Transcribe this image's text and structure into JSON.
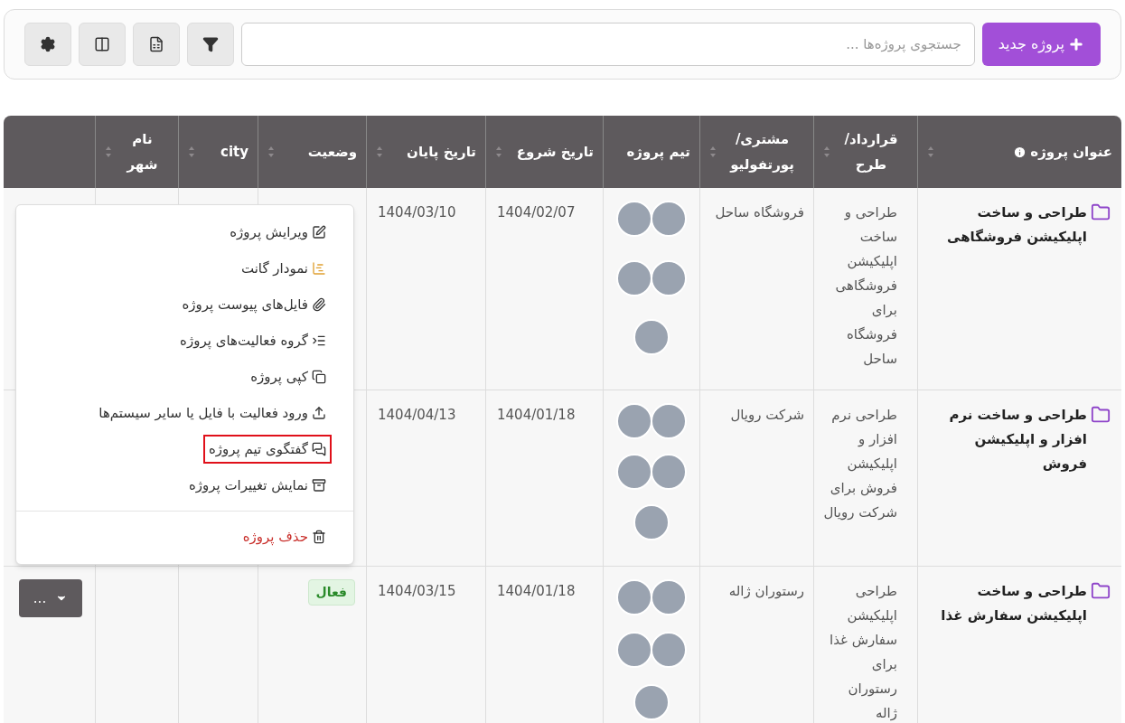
{
  "toolbar": {
    "new_button": "پروژه جدید",
    "search": {
      "placeholder": "جستجوی پروژه‌ها ..."
    },
    "tools": [
      {
        "kind": "filter"
      },
      {
        "kind": "excel"
      },
      {
        "kind": "columns"
      },
      {
        "kind": "settings"
      }
    ]
  },
  "table": {
    "columns": [
      {
        "label": "عنوان پروژه",
        "sortable": true,
        "info": true
      },
      {
        "label": "قرارداد/ طرح",
        "sortable": true,
        "info": false
      },
      {
        "label": "مشتری/ پورتفولیو",
        "sortable": true,
        "info": false
      },
      {
        "label": "تیم پروژه",
        "sortable": false,
        "info": false
      },
      {
        "label": "تاریخ شروع",
        "sortable": true,
        "info": false
      },
      {
        "label": "تاریخ پایان",
        "sortable": true,
        "info": false
      },
      {
        "label": "وضعیت",
        "sortable": true,
        "info": false
      },
      {
        "label": "city",
        "sortable": true,
        "info": false
      },
      {
        "label": "نام شهر",
        "sortable": true,
        "info": false
      }
    ],
    "rows": [
      {
        "title": "طراحی و ساخت اپلیکیشن فروشگاهی",
        "contract": "طراحی و ساخت اپلیکیشن فروشگاهی برای فروشگاه ساحل",
        "client": "فروشگاه ساحل",
        "team": [
          {
            "kind": "photo"
          },
          {
            "kind": "photo"
          },
          {
            "kind": "photo"
          },
          {
            "kind": "photo"
          },
          {
            "kind": "photo"
          }
        ],
        "start": "1404/02/07",
        "end": "1404/03/10"
      },
      {
        "title": "طراحی و ساخت نرم افزار و اپلیکیشن فروش",
        "contract": "طراحی نرم افزار و اپلیکیشن فروش برای شرکت رویال",
        "client": "شرکت رویال",
        "team": [
          {
            "kind": "photo"
          },
          {
            "kind": "photo"
          },
          {
            "kind": "photo"
          },
          {
            "kind": "photo"
          },
          {
            "kind": "photo"
          }
        ],
        "start": "1404/01/18",
        "end": "1404/04/13"
      },
      {
        "title": "طراحی و ساخت اپلیکیشن سفارش غذا",
        "contract": "طراحی اپلیکیشن سفارش غذا برای رستوران ژاله",
        "client": "رستوران ژاله",
        "team": [
          {
            "kind": "photo"
          },
          {
            "kind": "photo"
          },
          {
            "kind": "photo"
          },
          {
            "kind": "photo"
          },
          {
            "kind": "photo"
          }
        ],
        "start": "1404/01/18",
        "end": "1404/03/15",
        "status": "فعال",
        "actions": "..."
      }
    ]
  },
  "menu": {
    "items": [
      {
        "kind": "edit",
        "label": "ویرایش پروژه",
        "highlighted": false
      },
      {
        "kind": "gantt",
        "label": "نمودار گانت",
        "highlighted": false
      },
      {
        "kind": "attach",
        "label": "فایل‌های پیوست پروژه",
        "highlighted": false
      },
      {
        "kind": "group",
        "label": "گروه فعالیت‌های پروژه",
        "highlighted": false
      },
      {
        "kind": "copy",
        "label": "کپی پروژه",
        "highlighted": false
      },
      {
        "kind": "import",
        "label": "ورود فعالیت با فایل یا سایر سیستم‌ها",
        "highlighted": false
      },
      {
        "kind": "chat",
        "label": "گفتگوی تیم پروژه",
        "highlighted": true
      },
      {
        "kind": "history",
        "label": "نمایش تغییرات پروژه",
        "highlighted": false
      },
      {
        "kind": "delete",
        "label": "حذف پروژه",
        "highlighted": false
      }
    ]
  }
}
